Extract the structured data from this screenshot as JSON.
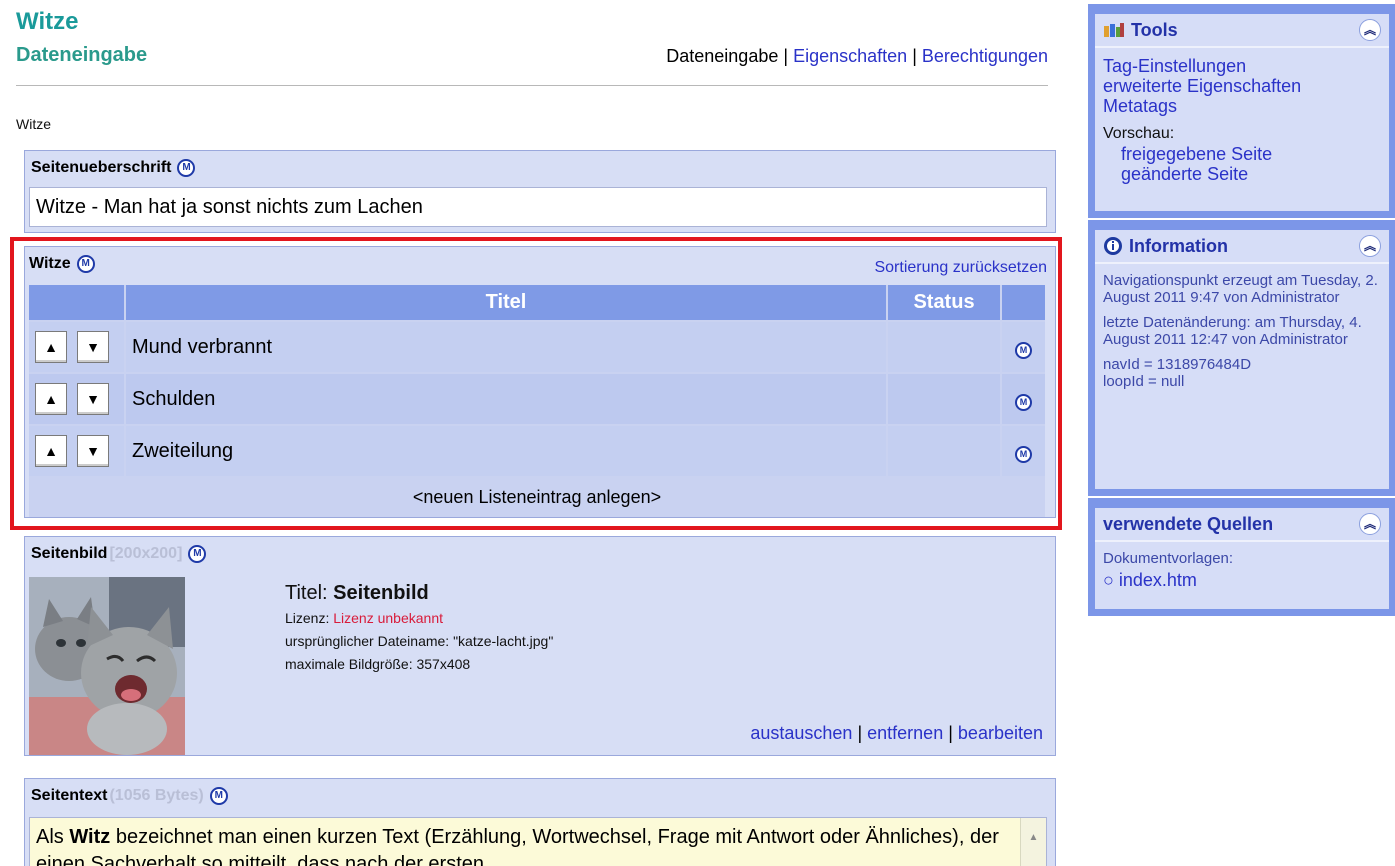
{
  "header": {
    "title": "Witze",
    "subtitle": "Dateneingabe",
    "tabs": [
      "Dateneingabe",
      "Eigenschaften",
      "Berechtigungen"
    ],
    "separator": "|",
    "crumb": "Witze"
  },
  "heading_panel": {
    "label": "Seitenueberschrift",
    "value": "Witze - Man hat ja sonst nichts zum Lachen"
  },
  "list_panel": {
    "label": "Witze",
    "reset_sort": "Sortierung zurücksetzen",
    "columns": [
      "Titel",
      "Status"
    ],
    "rows": [
      {
        "title": "Mund verbrannt",
        "status": ""
      },
      {
        "title": "Schulden",
        "status": ""
      },
      {
        "title": "Zweiteilung",
        "status": ""
      }
    ],
    "new_entry": "<neuen Listeneintrag anlegen>",
    "up_glyph": "▲",
    "down_glyph": "▼"
  },
  "image_panel": {
    "label": "Seitenbild",
    "size": "[200x200]",
    "title_label": "Titel:",
    "title_value": "Seitenbild",
    "license_label": "Lizenz:",
    "license_value": "Lizenz unbekannt",
    "filename_line": "ursprünglicher Dateiname: \"katze-lacht.jpg\"",
    "maxsize_line": "maximale Bildgröße: 357x408",
    "actions": [
      "austauschen",
      "entfernen",
      "bearbeiten"
    ]
  },
  "text_panel": {
    "label": "Seitentext",
    "size": "(1056 Bytes)",
    "text_prefix": "Als ",
    "text_bold": "Witz",
    "text_rest": " bezeichnet man einen kurzen Text (Erzählung, Wortwechsel, Frage mit Antwort oder Ähnliches), der einen Sachverhalt so mitteilt, dass nach der ersten"
  },
  "sidebar": {
    "tools": {
      "title": "Tools",
      "links": [
        "Tag-Einstellungen",
        "erweiterte Eigenschaften",
        "Metatags"
      ],
      "preview_label": "Vorschau:",
      "preview_links": [
        "freigegebene Seite",
        "geänderte Seite"
      ]
    },
    "info": {
      "title": "Information",
      "created": "Navigationspunkt erzeugt am Tuesday, 2. August 2011 9:47 von Administrator",
      "changed": "letzte Datenänderung: am Thursday, 4. August 2011 12:47 von Administrator",
      "navid": "navId = 1318976484D",
      "loopid": "loopId = null"
    },
    "sources": {
      "title": "verwendete Quellen",
      "label": "Dokumentvorlagen:",
      "items": [
        "index.htm"
      ]
    },
    "collapse_glyph": "«"
  },
  "icons": {
    "m_glyph": "M"
  }
}
